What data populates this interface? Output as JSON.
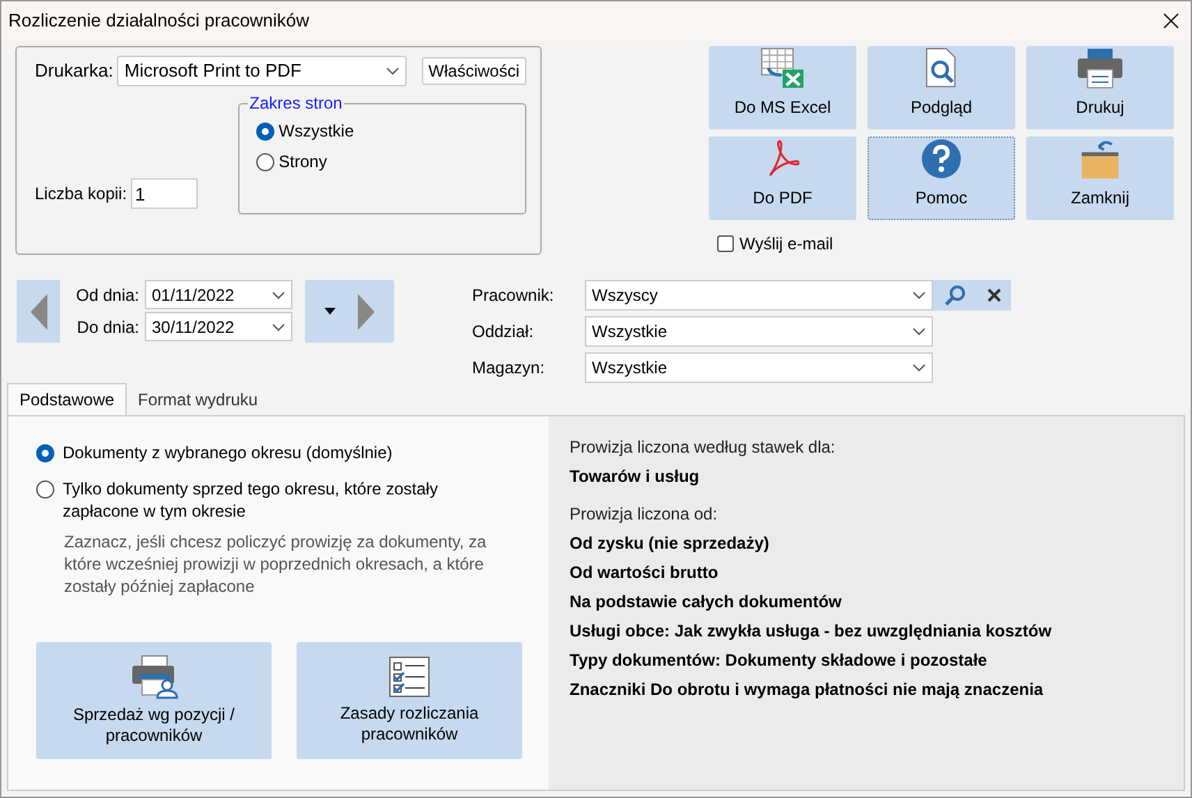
{
  "window": {
    "title": "Rozliczenie działalności pracowników"
  },
  "printer": {
    "label": "Drukarka:",
    "value": "Microsoft Print to PDF",
    "properties_button": "Właściwości"
  },
  "page_range": {
    "title": "Zakres stron",
    "options": [
      {
        "label": "Wszystkie",
        "selected": true
      },
      {
        "label": "Strony",
        "selected": false
      }
    ]
  },
  "copies": {
    "label": "Liczba kopii:",
    "value": "1"
  },
  "actions": [
    {
      "label": "Do MS Excel",
      "kind": "excel",
      "focused": false
    },
    {
      "label": "Podgląd",
      "kind": "preview",
      "focused": false
    },
    {
      "label": "Drukuj",
      "kind": "print",
      "focused": false
    },
    {
      "label": "Do PDF",
      "kind": "pdf",
      "focused": false
    },
    {
      "label": "Pomoc",
      "kind": "help",
      "focused": true
    },
    {
      "label": "Zamknij",
      "kind": "close",
      "focused": false
    }
  ],
  "send_email": {
    "label": "Wyślij e-mail",
    "checked": false
  },
  "dates": [
    {
      "label": "Od dnia:",
      "value": "01/11/2022"
    },
    {
      "label": "Do dnia:",
      "value": "30/11/2022"
    }
  ],
  "filters": [
    {
      "label": "Pracownik:",
      "value": "Wszyscy",
      "kind": "search"
    },
    {
      "label": "Oddział:",
      "value": "Wszystkie",
      "kind": "plain"
    },
    {
      "label": "Magazyn:",
      "value": "Wszystkie",
      "kind": "plain"
    }
  ],
  "tabs": [
    {
      "label": "Podstawowe",
      "selected": true
    },
    {
      "label": "Format wydruku",
      "selected": false
    }
  ],
  "period_options": [
    {
      "label": "Dokumenty z wybranego okresu (domyślnie)",
      "selected": true
    },
    {
      "label": "Tylko dokumenty sprzed tego okresu, które zostały zapłacone w tym okresie",
      "selected": false
    }
  ],
  "hint": "Zaznacz, jeśli chcesz policzyć prowizję za dokumenty, za które wcześniej prowizji w poprzednich okresach, a które zostały później zapłacone",
  "report_buttons": [
    {
      "label": "Sprzedaż wg pozycji / pracowników",
      "kind": "printer-user"
    },
    {
      "label": "Zasady rozliczania pracowników",
      "kind": "checklist"
    }
  ],
  "summary": [
    {
      "text": "Prowizja liczona według stawek dla:",
      "kind": "heading"
    },
    {
      "text": "Towarów i usług",
      "kind": "value"
    },
    {
      "text": "Prowizja liczona od:",
      "kind": "heading"
    },
    {
      "text": "Od zysku (nie sprzedaży)",
      "kind": "value"
    },
    {
      "text": "Od wartości brutto",
      "kind": "value"
    },
    {
      "text": "Na podstawie całych dokumentów",
      "kind": "value"
    },
    {
      "text": "Usługi obce: Jak zwykła usługa - bez uwzględniania kosztów",
      "kind": "value"
    },
    {
      "text": "Typy dokumentów: Dokumenty składowe i pozostałe",
      "kind": "value"
    },
    {
      "text": "Znaczniki Do obrotu i wymaga płatności nie mają znaczenia",
      "kind": "value"
    }
  ]
}
